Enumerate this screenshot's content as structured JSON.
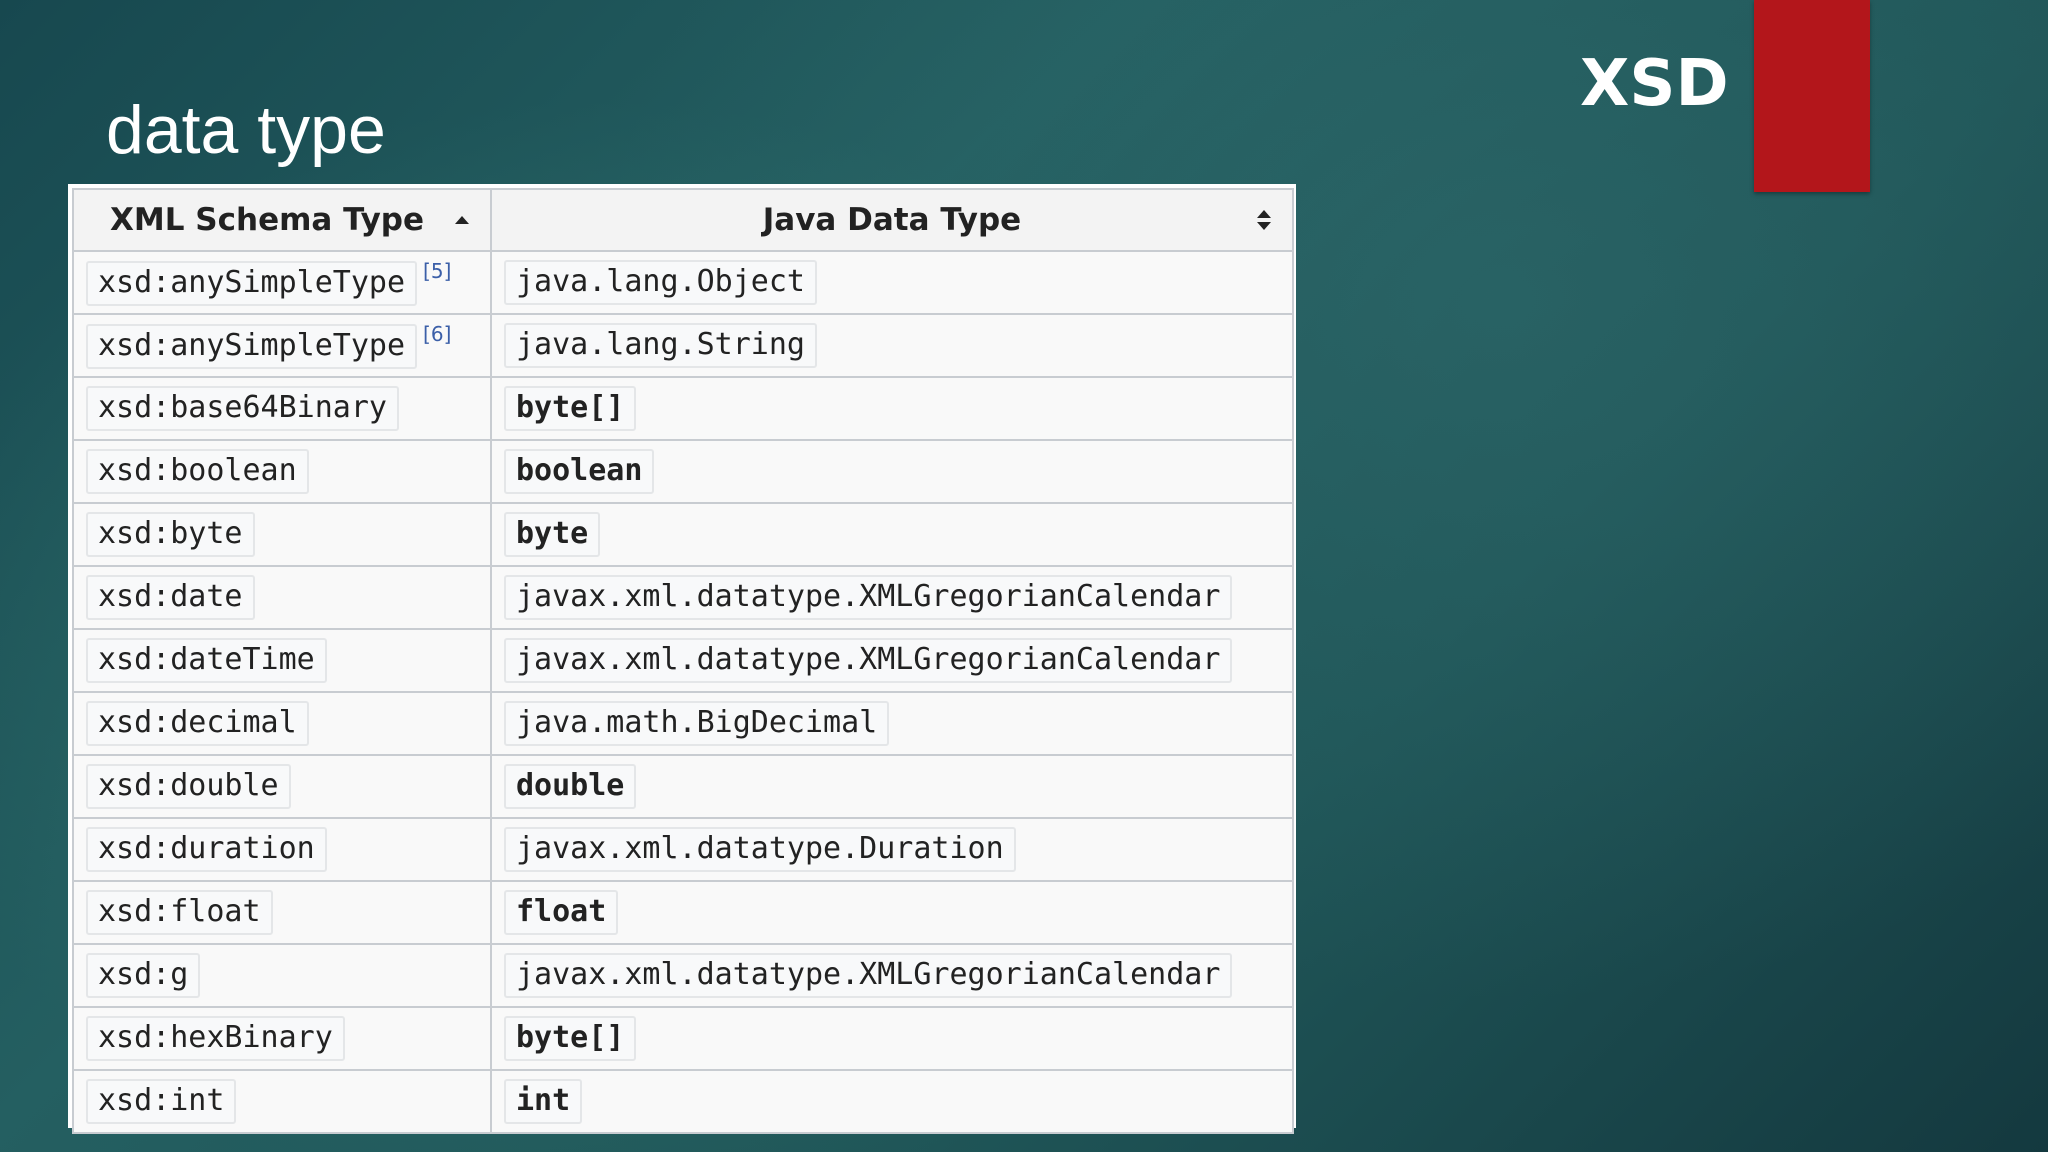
{
  "slide": {
    "title": "data type",
    "brand": "XSD",
    "accent_color": "#b3161b"
  },
  "table": {
    "headers": [
      "XML Schema Type",
      "Java Data Type"
    ],
    "sort_icons": [
      "sort-ascending-icon",
      "sort-both-icon"
    ],
    "rows": [
      {
        "xml": "xsd:anySimpleType",
        "ref": "[5]",
        "java": "java.lang.Object",
        "primitive": false
      },
      {
        "xml": "xsd:anySimpleType",
        "ref": "[6]",
        "java": "java.lang.String",
        "primitive": false
      },
      {
        "xml": "xsd:base64Binary",
        "ref": "",
        "java": "byte[]",
        "primitive": true
      },
      {
        "xml": "xsd:boolean",
        "ref": "",
        "java": "boolean",
        "primitive": true
      },
      {
        "xml": "xsd:byte",
        "ref": "",
        "java": "byte",
        "primitive": true
      },
      {
        "xml": "xsd:date",
        "ref": "",
        "java": "javax.xml.datatype.XMLGregorianCalendar",
        "primitive": false
      },
      {
        "xml": "xsd:dateTime",
        "ref": "",
        "java": "javax.xml.datatype.XMLGregorianCalendar",
        "primitive": false
      },
      {
        "xml": "xsd:decimal",
        "ref": "",
        "java": "java.math.BigDecimal",
        "primitive": false
      },
      {
        "xml": "xsd:double",
        "ref": "",
        "java": "double",
        "primitive": true
      },
      {
        "xml": "xsd:duration",
        "ref": "",
        "java": "javax.xml.datatype.Duration",
        "primitive": false
      },
      {
        "xml": "xsd:float",
        "ref": "",
        "java": "float",
        "primitive": true
      },
      {
        "xml": "xsd:g",
        "ref": "",
        "java": "javax.xml.datatype.XMLGregorianCalendar",
        "primitive": false
      },
      {
        "xml": "xsd:hexBinary",
        "ref": "",
        "java": "byte[]",
        "primitive": true
      },
      {
        "xml": "xsd:int",
        "ref": "",
        "java": "int",
        "primitive": true
      }
    ]
  }
}
